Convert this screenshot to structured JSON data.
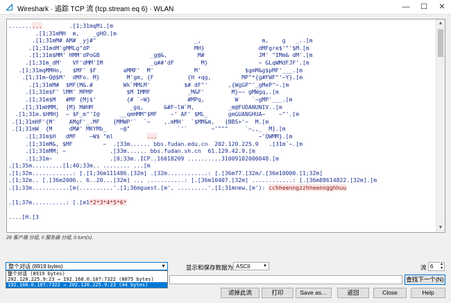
{
  "window": {
    "title": "Wireshark · 追踪 TCP 流 (tcp.stream eq 6) · WLAN",
    "minimize": "—",
    "maximize": "☐",
    "close": "✕",
    "icon": "wireshark-fin-icon"
  },
  "stream_lines": [
    {
      "t": ".......",
      "seg": [
        {
          "t": ".......",
          "c": "client"
        },
        {
          "t": "...",
          "c": "server"
        },
        {
          "t": "        .[1;31mqMi.[m",
          "c": "client"
        }
      ]
    },
    {
      "seg": [
        {
          "t": "        .[1;31mMH  m,    _gHO.[m",
          "c": "client"
        }
      ]
    },
    {
      "seg": [
        {
          "t": "       .[1;31mM# AM# _yj#\"                             _,                  m,    g   _..[m",
          "c": "client"
        }
      ]
    },
    {
      "seg": [
        {
          "t": "      .[1;31mdM'gMMLg\"dP                               MH}                dMFgre$'\"'$M.[m",
          "c": "client"
        }
      ]
    },
    {
      "seg": [
        {
          "t": "      .[1;31m$MM' HMM'dPoGB               _g@&,         M#                JM' \"IMm& dM'.[m",
          "c": "client"
        }
      ]
    },
    {
      "seg": [
        {
          "t": "     .[1;31m_dM'   VF'dMM'IM              _q##'dF        M}               ~ GLqWMdFJF'.[m",
          "c": "client"
        }
      ]
    },
    {
      "seg": [
        {
          "t": "   .[1;31mqMMHo,   $MF' $F        aMMF'  M'            M'             $gmM&g$pMF'___.[m",
          "c": "client"
        }
      ]
    },
    {
      "seg": [
        {
          "t": "    .[1;31m~Q@$M'  dMFo. M}        M'gm, {F          {H +qg,         MP\"*{g#FWF\"'~Y}.[m",
          "c": "client"
        }
      ]
    },
    {
      "seg": [
        {
          "t": "      .[1;31mM#  $MF(M&.#         Wk`MMLM'          $# dF\"'      ,{WgGP\"'_gMeP\"~.[m",
          "c": "client"
        }
      ]
    },
    {
      "seg": [
        {
          "t": "     .[1;31m$F' lMM' MPMP          $M IMMF           _M&F'        M}~~ gMWgq,.[m",
          "c": "client"
        }
      ]
    },
    {
      "seg": [
        {
          "t": "     .[1;31m$M   #MF {Mj$'         {# `~W}           #MPq,         W    `~gMP'___.[m",
          "c": "client"
        }
      ]
    },
    {
      "seg": [
        {
          "t": "    .[1;31mHMM,  {M} M#HM           _gq,      &#F~lW`M,          _m@FUDANUNIV..[m",
          "c": "client"
        }
      ]
    },
    {
      "seg": [
        {
          "t": "  .[1;31m.$HMH}  ~ $F_m\"'I@      __qmHMM\"$MF    ~' AF' $ML_      gmGUANGHUA~    ~\"'.[m",
          "c": "client"
        }
      ]
    },
    {
      "seg": [
        {
          "t": " .[1;31mHF'{M'    AMgF'_.MF    {MMWP'`  `~    ,.mMH'  `$MM&m,   {BBS+'~  M.[m",
          "c": "client"
        }
      ]
    },
    {
      "seg": [
        {
          "t": " .[1;31mW  {M     dM#' MKYMb_    ~@\"              `'`       ~'\"\"\"     `~,,_  M}.[m",
          "c": "client"
        }
      ]
    },
    {
      "seg": [
        {
          "t": "     .[1;31m$H   dMF    ~W$ \"ml          ",
          "c": "client"
        },
        {
          "t": "...",
          "c": "server"
        },
        {
          "t": "                              ~'QWMM}.[m",
          "c": "client"
        }
      ]
    },
    {
      "seg": [
        {
          "t": "     .[1;31mM&, $MF         ~  .[33m...... bbs.fudan.edu.cn  202.120.225.9   .[31m`~.[m",
          "c": "client"
        }
      ]
    },
    {
      "seg": [
        {
          "t": "     .[1;31mMM; ~             .[33m...... bbs.fudan.sh.cn  61.129.42.9.[m",
          "c": "client"
        }
      ]
    },
    {
      "seg": [
        {
          "t": "     .[1;31m~                 .[0;33m..ICP..16018209 ..........31009102000048.[m",
          "c": "client"
        }
      ]
    },
    {
      "seg": [
        {
          "t": ".[1;35m.........[1;40;33m.. ........ ...[m",
          "c": "client"
        }
      ]
    },
    {
      "seg": [
        {
          "t": ".[1;32m............: [.[1;36m111486.[32m] .[32m............: [.[36m77.[32m/.[36m10000.[1;32m]",
          "c": "client"
        }
      ]
    },
    {
      "seg": [
        {
          "t": ".[1;32m.. [.[36m2006.. 6..20...[32m] .., ...........: [.[36m10407.[32m] ............: [.[36m88614822.[32m].[m",
          "c": "client"
        }
      ]
    },
    {
      "seg": [
        {
          "t": ".[1;33m...........[m(..........'.[1;36mguest.[m', .........'.[1;31mnew.[m'): ",
          "c": "client"
        },
        {
          "t": "cchheenngzzhheenngghhuu",
          "c": "server"
        }
      ]
    },
    {
      "seg": [
        {
          "t": "",
          "c": "client"
        }
      ]
    },
    {
      "seg": [
        {
          "t": ".[1;37m..........: [.[m1",
          "c": "client"
        },
        {
          "t": "*2*3*4*5*6*",
          "c": "server"
        }
      ]
    },
    {
      "seg": [
        {
          "t": "",
          "c": "client"
        }
      ]
    },
    {
      "seg": [
        {
          "t": "....[H.[3",
          "c": "client"
        }
      ]
    }
  ],
  "status": "28 客户端 分组, 0 服务器 分组, 0 turn(s).",
  "conversation": {
    "selected": "整个对话 (8919 bytes)",
    "options": [
      "整个对话 (8919 bytes)",
      "202.120.225.9:23 → 192.168.0.107:7322 (8875 bytes)",
      "192.168.0.107:7322 → 202.120.225.9:23 (44 bytes)"
    ],
    "highlighted_index": 2
  },
  "display_as_label": "显示和保存数据为",
  "display_as_value": "ASCII",
  "stream_label": "流",
  "stream_value": "6",
  "find_next_label": "查找下一个(N)",
  "buttons": {
    "filter_out": "滤掉此流",
    "print": "打印",
    "save_as": "Save as…",
    "back": "返回",
    "close": "Close",
    "help": "Help"
  },
  "colors": {
    "client": "#1a2e8e",
    "server": "#8a0f0f",
    "selection": "#0078d7"
  }
}
